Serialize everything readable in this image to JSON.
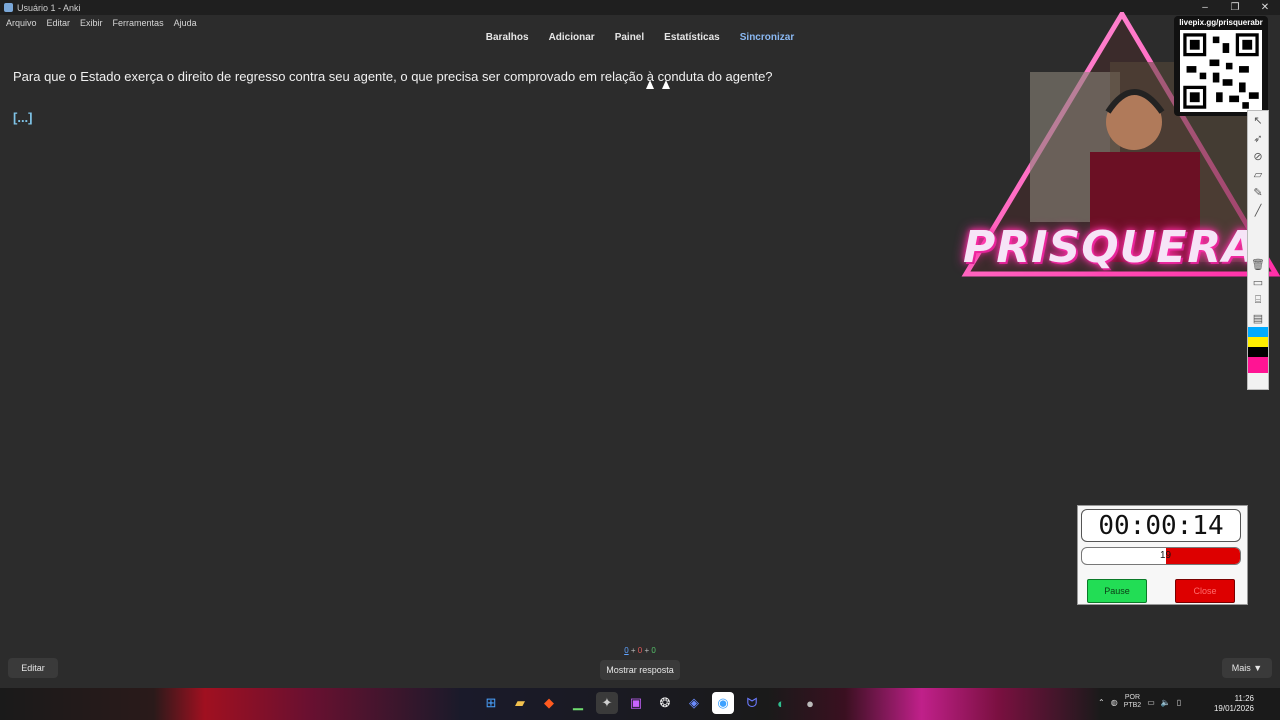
{
  "window": {
    "title": "Usuário 1 - Anki",
    "controls": [
      "–",
      "❐",
      "✕"
    ]
  },
  "menu": [
    "Arquivo",
    "Editar",
    "Exibir",
    "Ferramentas",
    "Ajuda"
  ],
  "toolbar": {
    "decks": "Baralhos",
    "add": "Adicionar",
    "browse": "Painel",
    "stats": "Estatísticas",
    "sync": "Sincronizar"
  },
  "card": {
    "question": "Para que o Estado exerça o direito de regresso contra seu agente, o que precisa ser comprovado em relação à conduta do agente?",
    "cloze": "[...]"
  },
  "overlay": {
    "brand": "PRISQUERA",
    "qr_caption": "livepix.gg/prisquerabr",
    "accent": "#ff2fa8"
  },
  "timer": {
    "time": "00:00:14",
    "bar_value": "19",
    "bar_fill_fraction": 0.47,
    "pause": "Pause",
    "close": "Close"
  },
  "bottom": {
    "counts": {
      "new": "0",
      "plus1": " + ",
      "learn": "0",
      "plus2": " + ",
      "review": "0"
    },
    "edit": "Editar",
    "show_answer": "Mostrar resposta",
    "more": "Mais ▼"
  },
  "taskbar": {
    "lang_line1": "POR",
    "lang_line2": "PTB2",
    "time": "11:26",
    "date": "19/01/2026"
  }
}
